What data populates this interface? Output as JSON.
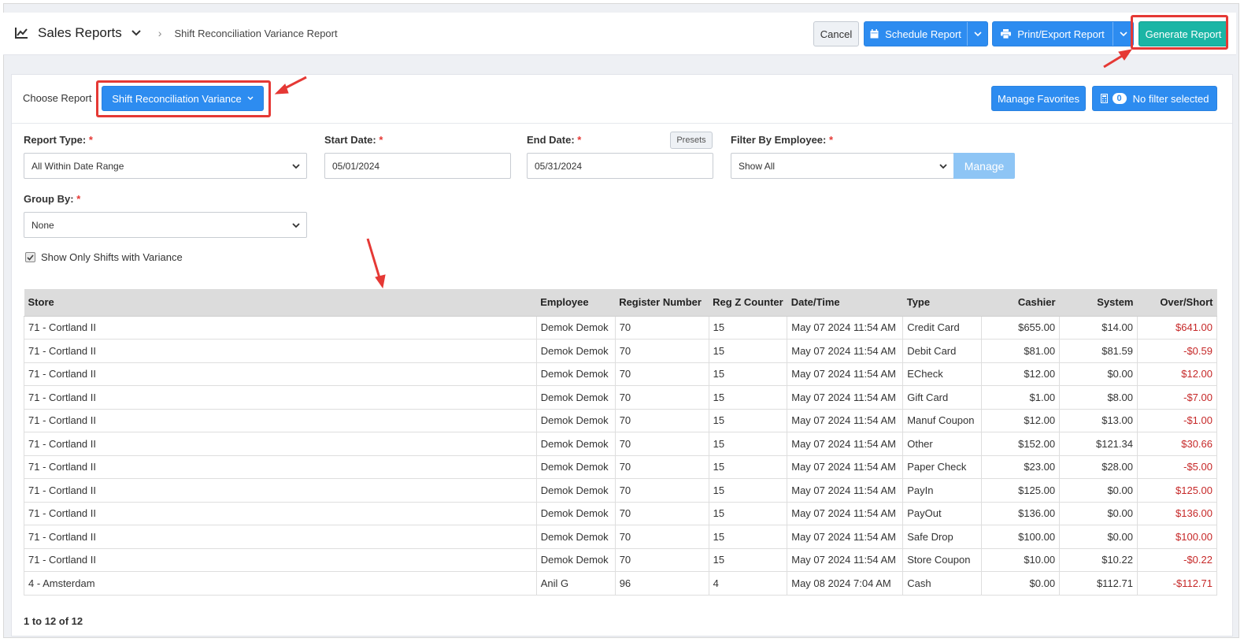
{
  "header": {
    "app_title": "Sales Reports",
    "breadcrumb": "Shift Reconciliation Variance Report",
    "buttons": {
      "cancel": "Cancel",
      "schedule": "Schedule Report",
      "print_export": "Print/Export Report",
      "generate": "Generate Report"
    }
  },
  "toolbar": {
    "choose_label": "Choose Report",
    "report_selected": "Shift Reconciliation Variance",
    "manage_favorites": "Manage Favorites",
    "filter_count": "0",
    "filter_label": "No filter selected"
  },
  "filters": {
    "report_type": {
      "label": "Report Type:",
      "value": "All Within Date Range"
    },
    "start_date": {
      "label": "Start Date:",
      "value": "05/01/2024"
    },
    "end_date": {
      "label": "End Date:",
      "value": "05/31/2024"
    },
    "presets": "Presets",
    "employee": {
      "label": "Filter By Employee:",
      "value": "Show All"
    },
    "manage": "Manage",
    "group_by": {
      "label": "Group By:",
      "value": "None"
    },
    "required_mark": "*",
    "show_variance": {
      "label": "Show Only Shifts with Variance",
      "checked": true
    }
  },
  "table": {
    "columns": [
      "Store",
      "Employee",
      "Register Number",
      "Reg Z Counter",
      "Date/Time",
      "Type",
      "Cashier",
      "System",
      "Over/Short"
    ],
    "rows": [
      [
        "71 - Cortland II",
        "Demok Demok",
        "70",
        "15",
        "May 07 2024 11:54 AM",
        "Credit Card",
        "$655.00",
        "$14.00",
        "$641.00"
      ],
      [
        "71 - Cortland II",
        "Demok Demok",
        "70",
        "15",
        "May 07 2024 11:54 AM",
        "Debit Card",
        "$81.00",
        "$81.59",
        "-$0.59"
      ],
      [
        "71 - Cortland II",
        "Demok Demok",
        "70",
        "15",
        "May 07 2024 11:54 AM",
        "ECheck",
        "$12.00",
        "$0.00",
        "$12.00"
      ],
      [
        "71 - Cortland II",
        "Demok Demok",
        "70",
        "15",
        "May 07 2024 11:54 AM",
        "Gift Card",
        "$1.00",
        "$8.00",
        "-$7.00"
      ],
      [
        "71 - Cortland II",
        "Demok Demok",
        "70",
        "15",
        "May 07 2024 11:54 AM",
        "Manuf Coupon",
        "$12.00",
        "$13.00",
        "-$1.00"
      ],
      [
        "71 - Cortland II",
        "Demok Demok",
        "70",
        "15",
        "May 07 2024 11:54 AM",
        "Other",
        "$152.00",
        "$121.34",
        "$30.66"
      ],
      [
        "71 - Cortland II",
        "Demok Demok",
        "70",
        "15",
        "May 07 2024 11:54 AM",
        "Paper Check",
        "$23.00",
        "$28.00",
        "-$5.00"
      ],
      [
        "71 - Cortland II",
        "Demok Demok",
        "70",
        "15",
        "May 07 2024 11:54 AM",
        "PayIn",
        "$125.00",
        "$0.00",
        "$125.00"
      ],
      [
        "71 - Cortland II",
        "Demok Demok",
        "70",
        "15",
        "May 07 2024 11:54 AM",
        "PayOut",
        "$136.00",
        "$0.00",
        "$136.00"
      ],
      [
        "71 - Cortland II",
        "Demok Demok",
        "70",
        "15",
        "May 07 2024 11:54 AM",
        "Safe Drop",
        "$100.00",
        "$0.00",
        "$100.00"
      ],
      [
        "71 - Cortland II",
        "Demok Demok",
        "70",
        "15",
        "May 07 2024 11:54 AM",
        "Store Coupon",
        "$10.00",
        "$10.22",
        "-$0.22"
      ],
      [
        "4 - Amsterdam",
        "Anil G",
        "96",
        "4",
        "May 08 2024 7:04 AM",
        "Cash",
        "$0.00",
        "$112.71",
        "-$112.71"
      ]
    ]
  },
  "pagination": "1 to 12 of 12",
  "colors": {
    "primary_blue": "#2d8cf0",
    "generate_teal": "#1bb5a5",
    "negative_red": "#c62828",
    "annotation_red": "#e53935"
  }
}
